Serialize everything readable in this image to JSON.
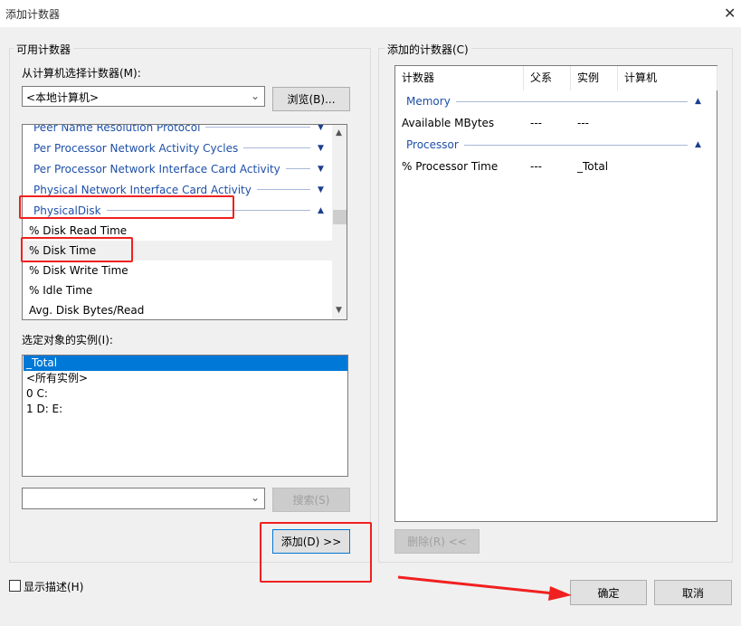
{
  "window": {
    "title": "添加计数器",
    "close": "✕"
  },
  "available": {
    "label": "可用计数器",
    "computer_label": "从计算机选择计数器(M):",
    "computer_value": "<本地计算机>",
    "browse": "浏览(B)...",
    "counters": [
      {
        "type": "group",
        "label": "Peer Name Resolution Protocol",
        "expanded": false
      },
      {
        "type": "group",
        "label": "Per Processor Network Activity Cycles",
        "expanded": false
      },
      {
        "type": "group",
        "label": "Per Processor Network Interface Card Activity",
        "expanded": false
      },
      {
        "type": "group",
        "label": "Physical Network Interface Card Activity",
        "expanded": false
      },
      {
        "type": "group",
        "label": "PhysicalDisk",
        "expanded": true
      },
      {
        "type": "counter",
        "label": "% Disk Read Time"
      },
      {
        "type": "counter",
        "label": "% Disk Time",
        "selected": true
      },
      {
        "type": "counter",
        "label": "% Disk Write Time"
      },
      {
        "type": "counter",
        "label": "% Idle Time"
      },
      {
        "type": "counter",
        "label": "Avg. Disk Bytes/Read"
      }
    ],
    "instances_label": "选定对象的实例(I):",
    "instances": [
      "_Total",
      "<所有实例>",
      "0 C:",
      "1 D: E:"
    ],
    "selected_instance": "_Total",
    "search_value": "",
    "search": "搜索(S)",
    "add": "添加(D) >>"
  },
  "added": {
    "label": "添加的计数器(C)",
    "columns": [
      "计数器",
      "父系",
      "实例",
      "计算机"
    ],
    "groups": [
      {
        "name": "Memory",
        "rows": [
          [
            "Available MBytes",
            "---",
            "---",
            ""
          ]
        ]
      },
      {
        "name": "Processor",
        "rows": [
          [
            "% Processor Time",
            "---",
            "_Total",
            ""
          ]
        ]
      }
    ],
    "remove": "删除(R) <<"
  },
  "show_description": {
    "label": "显示描述(H)",
    "checked": false
  },
  "ok": "确定",
  "cancel": "取消",
  "colors": {
    "accent": "#0078d7",
    "annotation": "#f02020",
    "group_text": "#1e4fa8"
  }
}
